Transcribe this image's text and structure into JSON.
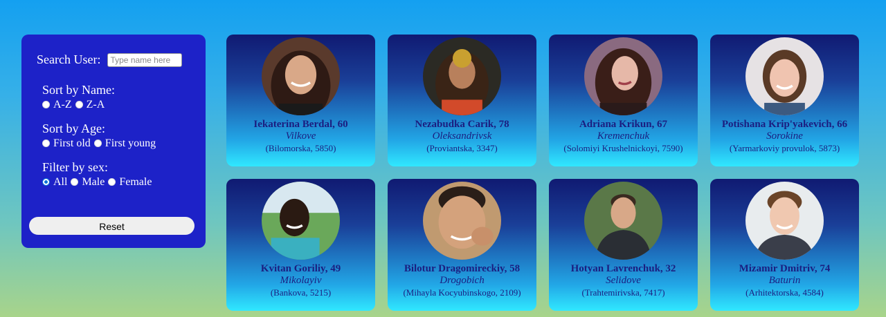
{
  "filters": {
    "search_label": "Search User:",
    "search_placeholder": "Type name here",
    "sort_name_title": "Sort by Name:",
    "sort_name_options": [
      "A-Z",
      "Z-A"
    ],
    "sort_age_title": "Sort by Age:",
    "sort_age_options": [
      "First old",
      "First young"
    ],
    "filter_sex_title": "Filter by sex:",
    "filter_sex_options": [
      "All",
      "Male",
      "Female"
    ],
    "filter_sex_selected": "All",
    "reset_label": "Reset"
  },
  "users": [
    {
      "name_age": "Iekaterina Berdal, 60",
      "city": "Vilkove",
      "address": "(Bilomorska, 5850)"
    },
    {
      "name_age": "Nezabudka Carik, 78",
      "city": "Oleksandrivsk",
      "address": "(Proviantska, 3347)"
    },
    {
      "name_age": "Adriana Krikun, 67",
      "city": "Kremenchuk",
      "address": "(Solomiyi Krushelnickoyi, 7590)"
    },
    {
      "name_age": "Potishana Krip'yakevich, 66",
      "city": "Sorokine",
      "address": "(Yarmarkoviy provulok, 5873)"
    },
    {
      "name_age": "Kvitan Goriliy, 49",
      "city": "Mikolayiv",
      "address": "(Bankova, 5215)"
    },
    {
      "name_age": "Bilotur Dragomireckiy, 58",
      "city": "Drogobich",
      "address": "(Mihayla Kocyubinskogo, 2109)"
    },
    {
      "name_age": "Hotyan Lavrenchuk, 32",
      "city": "Selidove",
      "address": "(Trahtemirivska, 7417)"
    },
    {
      "name_age": "Mizamir Dmitriv, 74",
      "city": "Baturin",
      "address": "(Arhitektorska, 4584)"
    }
  ],
  "colors": {
    "panel": "#1d22c8",
    "card_top": "#101a72",
    "card_bottom": "#30e8ff",
    "text": "#1b1e80"
  }
}
